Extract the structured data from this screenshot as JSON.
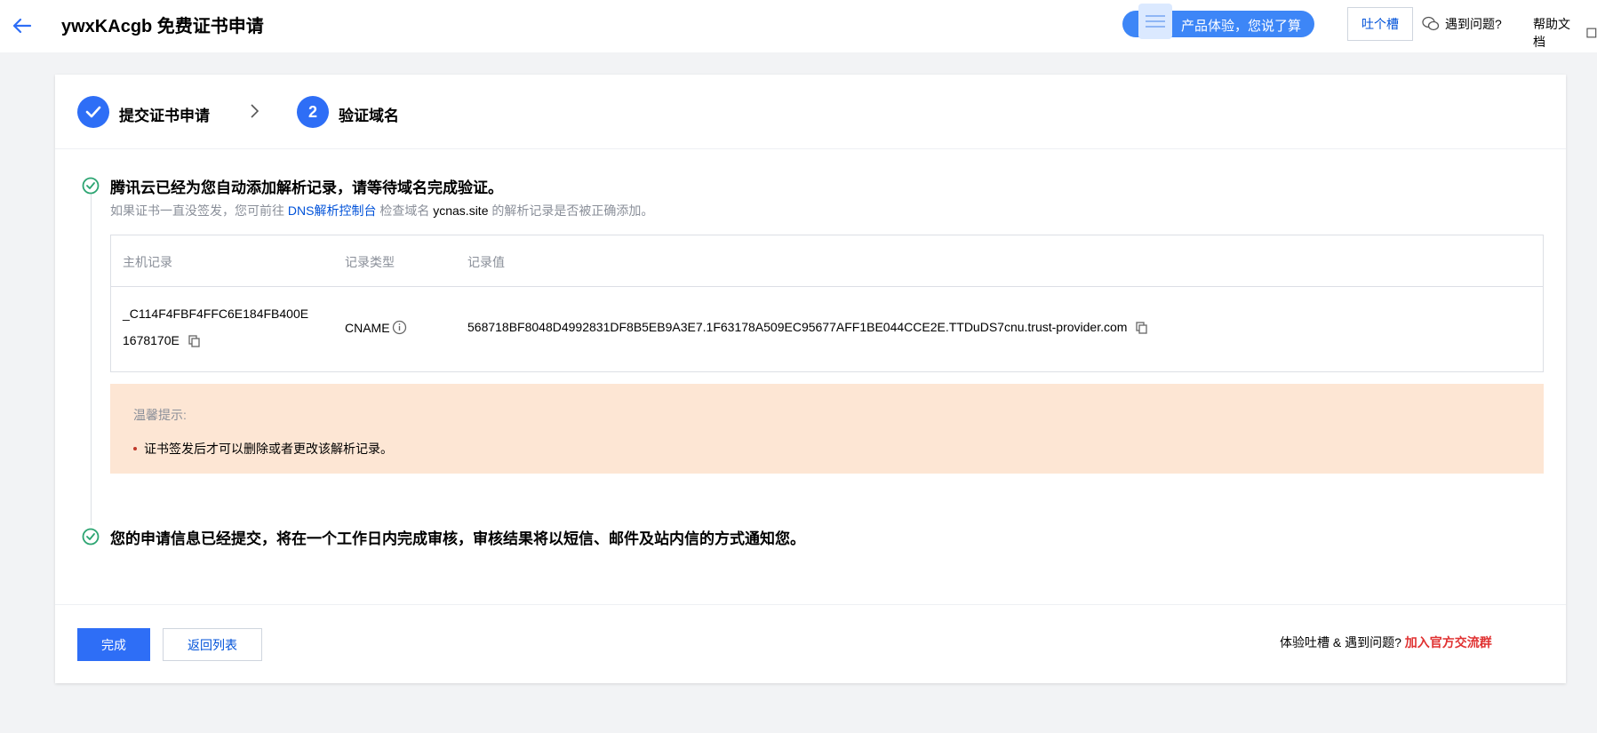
{
  "header": {
    "title": "ywxKAcgb 免费证书申请",
    "feedback_pill": "产品体验，您说了算",
    "tucao_label": "吐个槽",
    "problem_label": "遇到问题?",
    "docs_label": "帮助文档"
  },
  "steps": [
    {
      "label": "提交证书申请",
      "status": "done"
    },
    {
      "number": "2",
      "label": "验证域名",
      "status": "current"
    }
  ],
  "verify": {
    "title": "腾讯云已经为您自动添加解析记录，请等待域名完成验证。",
    "sub_prefix": "如果证书一直没签发，您可前往",
    "sub_link": "DNS解析控制台",
    "sub_middle": "检查域名",
    "sub_domain": "ycnas.site",
    "sub_suffix": "的解析记录是否被正确添加。"
  },
  "record_table": {
    "headers": [
      "主机记录",
      "记录类型",
      "记录值"
    ],
    "row": {
      "host_line1": "_C114F4FBF4FFC6E184FB400E",
      "host_line2": "1678170E",
      "type": "CNAME",
      "value": "568718BF8048D4992831DF8B5EB9A3E7.1F63178A509EC95677AFF1BE044CCE2E.TTDuDS7cnu.trust-provider.com"
    }
  },
  "tip": {
    "title": "温馨提示:",
    "item": "证书签发后才可以删除或者更改该解析记录。"
  },
  "submitted": {
    "title": "您的申请信息已经提交，将在一个工作日内完成审核，审核结果将以短信、邮件及站内信的方式通知您。"
  },
  "footer": {
    "done_label": "完成",
    "back_label": "返回列表",
    "join_prefix": "体验吐槽 & 遇到问题?",
    "join_link": "加入官方交流群"
  },
  "colors": {
    "primary": "#2e6ef6",
    "success": "#2ba471",
    "tip_bg": "#fde6d4",
    "link": "#0052d9",
    "danger": "#e03131"
  }
}
